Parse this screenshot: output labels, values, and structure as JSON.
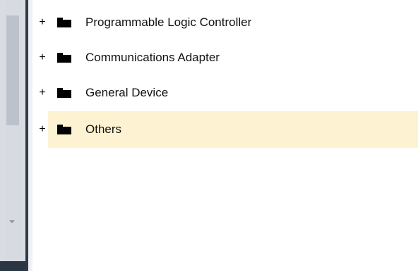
{
  "tree": {
    "items": [
      {
        "label": "Programmable Logic Controller",
        "expander": "+",
        "icon": "folder-icon",
        "selected": false
      },
      {
        "label": "Communications Adapter",
        "expander": "+",
        "icon": "folder-icon",
        "selected": false
      },
      {
        "label": "General Device",
        "expander": "+",
        "icon": "folder-icon",
        "selected": false
      },
      {
        "label": "Others",
        "expander": "+",
        "icon": "folder-icon",
        "selected": true
      }
    ]
  },
  "colors": {
    "selection_background": "#fdf3d2",
    "panel_background": "#d9dde3",
    "divider_dark": "#2f3949"
  }
}
